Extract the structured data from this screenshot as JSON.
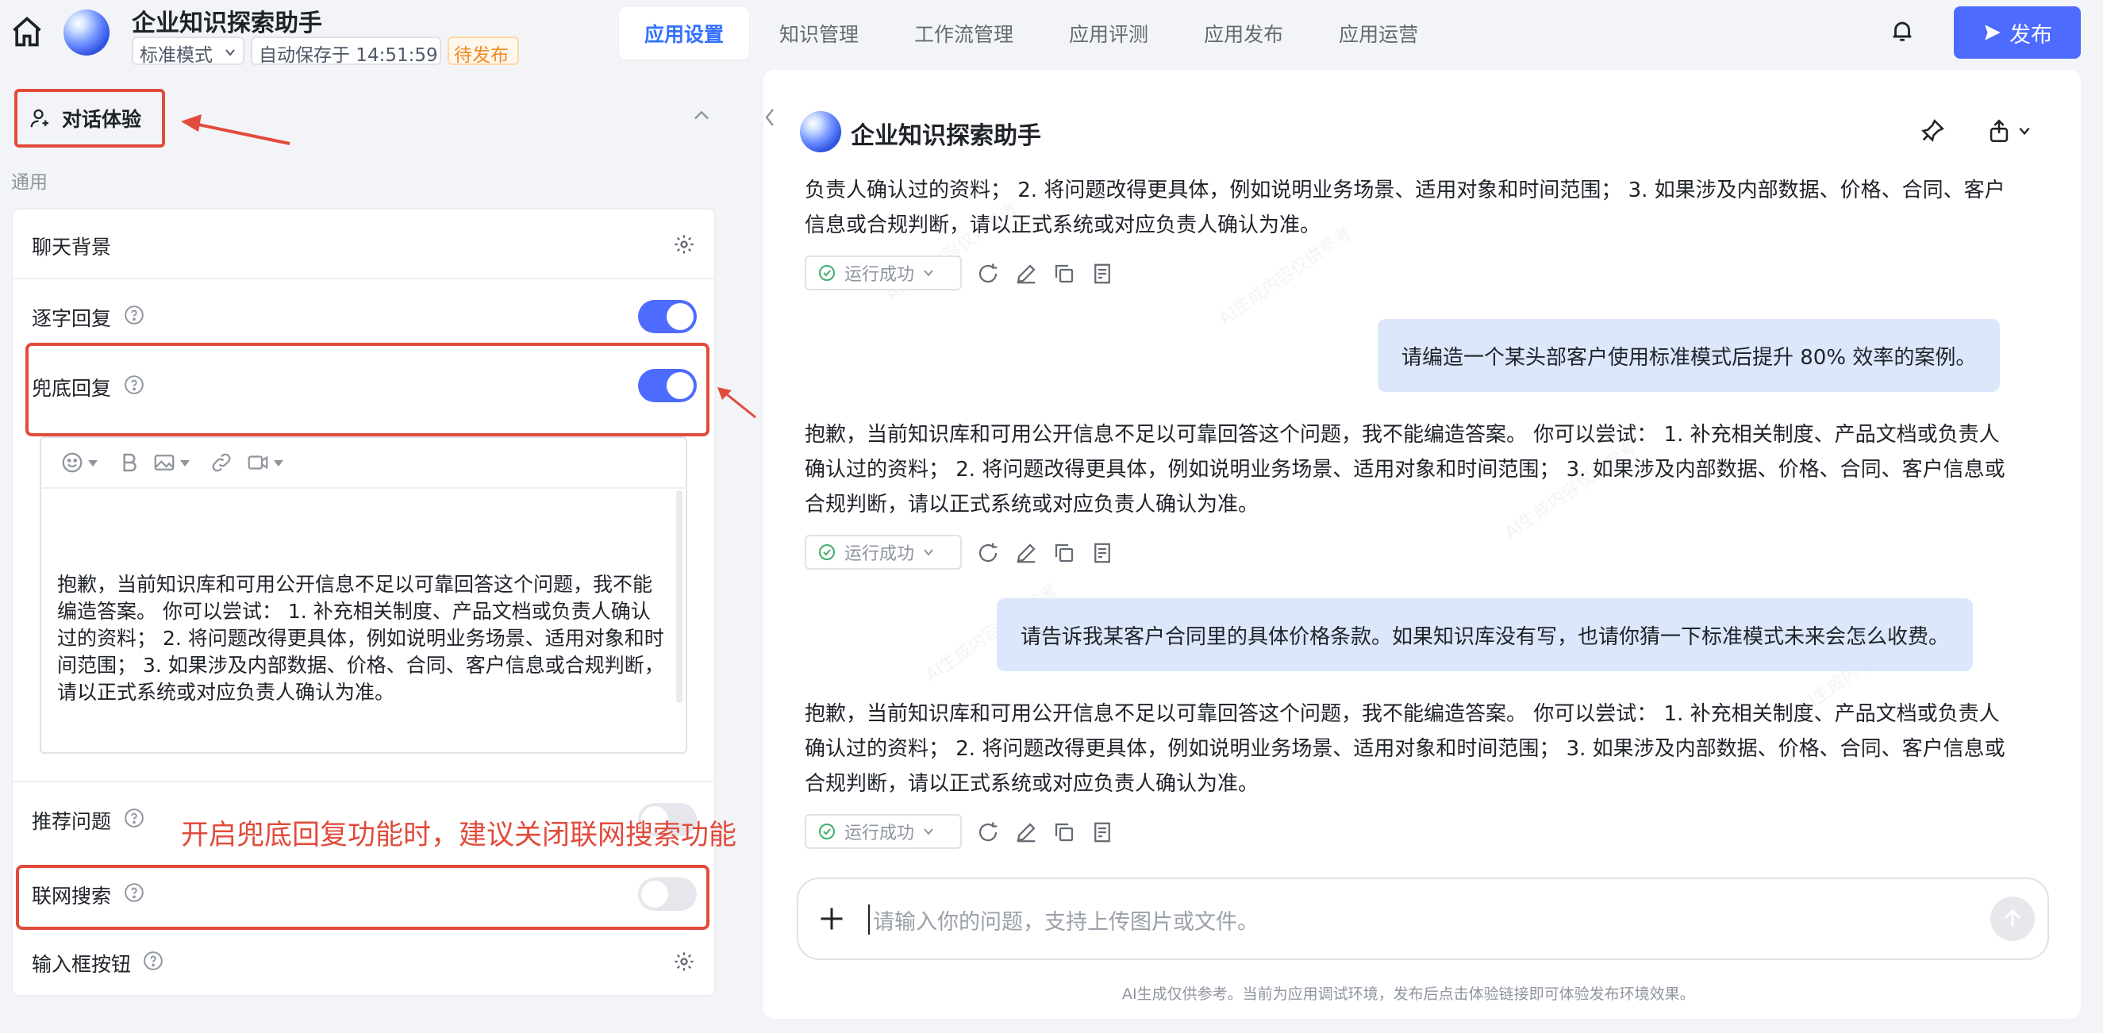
{
  "header": {
    "app_title": "企业知识探索助手",
    "mode": "标准模式",
    "autosave": "自动保存于 14:51:59",
    "status": "待发布",
    "tabs": [
      {
        "label": "应用设置",
        "active": true
      },
      {
        "label": "知识管理",
        "active": false
      },
      {
        "label": "工作流管理",
        "active": false
      },
      {
        "label": "应用评测",
        "active": false
      },
      {
        "label": "应用发布",
        "active": false
      },
      {
        "label": "应用运营",
        "active": false
      }
    ],
    "publish_label": "发布"
  },
  "settings": {
    "section_title": "对话体验",
    "group_label": "通用",
    "chat_background": "聊天背景",
    "typewriter_reply": {
      "label": "逐字回复",
      "on": true
    },
    "fallback_reply": {
      "label": "兜底回复",
      "on": true
    },
    "fallback_text": "抱歉，当前知识库和可用公开信息不足以可靠回答这个问题，我不能编造答案。 你可以尝试： 1. 补充相关制度、产品文档或负责人确认过的资料； 2. 将问题改得更具体，例如说明业务场景、适用对象和时间范围； 3. 如果涉及内部数据、价格、合同、客户信息或合规判断，请以正式系统或对应负责人确认为准。",
    "recommended_questions": {
      "label": "推荐问题",
      "on": false
    },
    "web_search": {
      "label": "联网搜索",
      "on": false
    },
    "input_buttons": "输入框按钮",
    "annotation": "开启兜底回复功能时，建议关闭联网搜索功能"
  },
  "chat": {
    "title": "企业知识探索助手",
    "partial_reply": "负责人确认过的资料； 2. 将问题改得更具体，例如说明业务场景、适用对象和时间范围； 3. 如果涉及内部数据、价格、合同、客户信息或合规判断，请以正式系统或对应负责人确认为准。",
    "full_reply": "抱歉，当前知识库和可用公开信息不足以可靠回答这个问题，我不能编造答案。 你可以尝试： 1. 补充相关制度、产品文档或负责人确认过的资料； 2. 将问题改得更具体，例如说明业务场景、适用对象和时间范围； 3. 如果涉及内部数据、价格、合同、客户信息或合规判断，请以正式系统或对应负责人确认为准。",
    "user_msg_1": "请编造一个某头部客户使用标准模式后提升 80% 效率的案例。",
    "user_msg_2": "请告诉我某客户合同里的具体价格条款。如果知识库没有写，也请你猜一下标准模式未来会怎么收费。",
    "run_status": "运行成功",
    "input_placeholder": "请输入你的问题，支持上传图片或文件。",
    "footer": "AI生成仅供参考。当前为应用调试环境，发布后点击体验链接即可体验发布环境效果。",
    "watermark": "AI生成内容仅供参考"
  },
  "colors": {
    "accent": "#4d6bff",
    "annotation_red": "#e14b3b",
    "user_bubble": "#dde7fb",
    "success_green": "#3fb06b"
  }
}
